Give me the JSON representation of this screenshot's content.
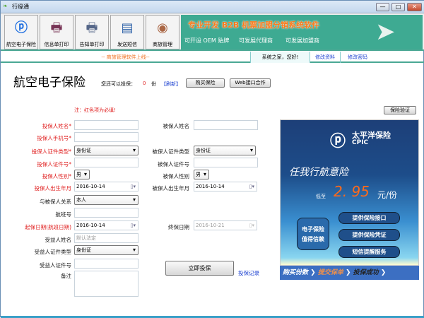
{
  "window": {
    "title": "行缘通",
    "min": "—",
    "max": "□",
    "close": "✕"
  },
  "toolbar": [
    {
      "label": "航空电子保险",
      "icon": "cpic-logo-icon"
    },
    {
      "label": "信息单打印",
      "icon": "printer-icon"
    },
    {
      "label": "告知单打印",
      "icon": "printer-paper-icon"
    },
    {
      "label": "发送短信",
      "icon": "message-icon"
    },
    {
      "label": "商旅管理",
      "icon": "travel-disc-icon"
    }
  ],
  "banner": {
    "headline": "专业开发 B2B 机票加盟分销系统软件",
    "items": [
      "可开设 OEM 贴牌",
      "可发展代理商",
      "可发展加盟商"
    ]
  },
  "strip": {
    "notice": "-- 商旅管理软件上线--",
    "greeting": "系统之家，您好!",
    "edit_profile": "修改资料",
    "change_password": "修改密码"
  },
  "page": {
    "title": "航空电子保险",
    "remaining_label": "您还可以投保：",
    "remaining_count": "0",
    "unit": "份",
    "refresh": "【刷新】",
    "buy": "购买保险",
    "web_api": "Web接口合作",
    "note": "注：红色项为必填!",
    "verify": "保险验证"
  },
  "form": {
    "applicant_name": {
      "label": "投保人姓名*",
      "value": ""
    },
    "insured_name": {
      "label": "被保人姓名",
      "value": ""
    },
    "applicant_phone": {
      "label": "投保人手机号*",
      "value": ""
    },
    "applicant_id_type": {
      "label": "投保人证件类型*",
      "value": "身份证"
    },
    "insured_id_type": {
      "label": "被保人证件类型",
      "value": "身份证"
    },
    "applicant_id": {
      "label": "投保人证件号*",
      "value": ""
    },
    "insured_id": {
      "label": "被保人证件号",
      "value": ""
    },
    "applicant_gender": {
      "label": "投保人性别*",
      "value": "男"
    },
    "insured_gender": {
      "label": "被保人性别",
      "value": "男"
    },
    "applicant_birth": {
      "label": "投保人出生年月",
      "value": "2016-10-14"
    },
    "insured_birth": {
      "label": "被保人出生年月",
      "value": "2016-10-14"
    },
    "relation": {
      "label": "与被保人关系",
      "value": "本人"
    },
    "flight": {
      "label": "航班号",
      "value": ""
    },
    "start_date": {
      "label": "起保日期(航班日期)",
      "value": "2016-10-14"
    },
    "end_date": {
      "label": "终保日期",
      "value": "2016-10-21"
    },
    "beneficiary_name": {
      "label": "受益人姓名",
      "placeholder": "默认法定"
    },
    "beneficiary_id_type": {
      "label": "受益人证件类型",
      "value": "身份证"
    },
    "beneficiary_id": {
      "label": "受益人证件号",
      "value": ""
    },
    "remarks": {
      "label": "备注",
      "value": ""
    },
    "submit": "立即投保",
    "records": "投保记录"
  },
  "ad": {
    "brand": "太平洋保险",
    "brand_en": "CPIC",
    "slogan": "任我行航意险",
    "price_prefix": "低至",
    "price": "2. 95",
    "price_unit": "元/份",
    "trust": [
      "电子保险",
      "值得信赖"
    ],
    "features": [
      "提供保险接口",
      "提供保险凭证",
      "短信提醒服务"
    ],
    "steps": [
      "购买份数",
      "提交保单",
      "投保成功"
    ]
  }
}
